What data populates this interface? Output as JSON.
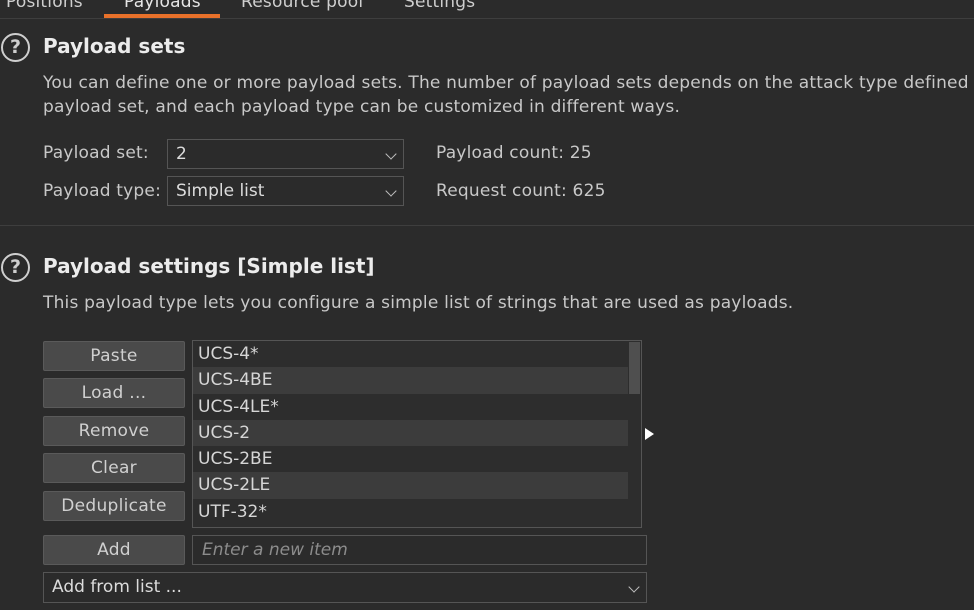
{
  "tabs": [
    {
      "label": "Positions"
    },
    {
      "label": "Payloads"
    },
    {
      "label": "Resource pool"
    },
    {
      "label": "Settings"
    }
  ],
  "payload_sets": {
    "help_glyph": "?",
    "title": "Payload sets",
    "description_line1": "You can define one or more payload sets. The number of payload sets depends on the attack type defined in",
    "description_line2": "payload set, and each payload type can be customized in different ways.",
    "set_label": "Payload set:",
    "set_value": "2",
    "type_label": "Payload type:",
    "type_value": "Simple list",
    "payload_count": "Payload count: 25",
    "request_count": "Request count: 625"
  },
  "payload_settings": {
    "help_glyph": "?",
    "title": "Payload settings [Simple list]",
    "description": "This payload type lets you configure a simple list of strings that are used as payloads.",
    "buttons": {
      "paste": "Paste",
      "load": "Load ...",
      "remove": "Remove",
      "clear": "Clear",
      "deduplicate": "Deduplicate",
      "add": "Add"
    },
    "items": [
      "UCS-4*",
      "UCS-4BE",
      "UCS-4LE*",
      "UCS-2",
      "UCS-2BE",
      "UCS-2LE",
      "UTF-32*"
    ],
    "new_item_placeholder": "Enter a new item",
    "add_from_list": "Add from list ..."
  },
  "colors": {
    "background": "#2b2b2b",
    "accent": "#e8712a",
    "button": "#4a4a4a"
  }
}
